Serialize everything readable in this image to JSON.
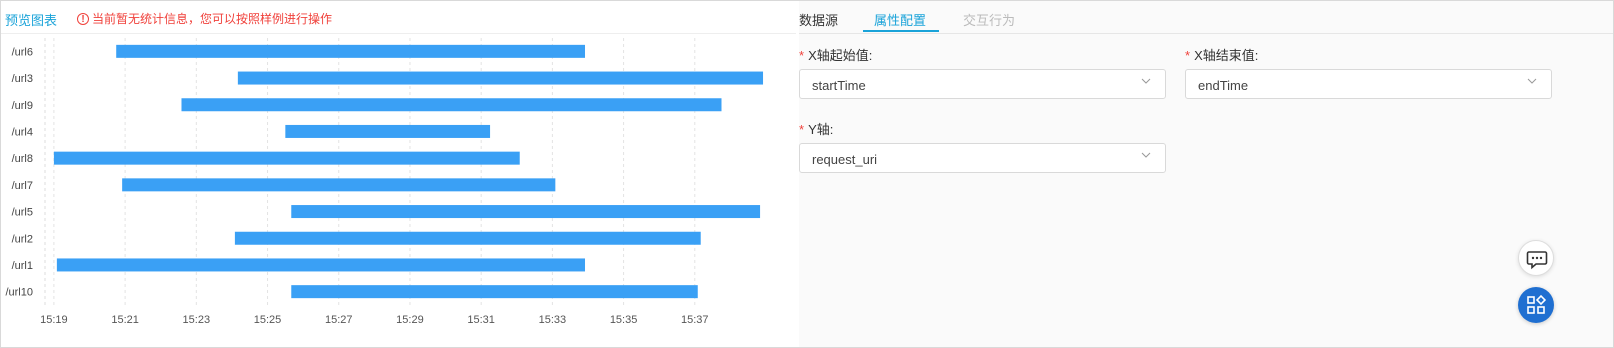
{
  "preview": {
    "title": "预览图表",
    "warning_icon": "exclamation-circle-icon",
    "warning": "当前暂无统计信息，您可以按照样例进行操作"
  },
  "tabs": [
    {
      "label": "数据源",
      "state": "normal"
    },
    {
      "label": "属性配置",
      "state": "active"
    },
    {
      "label": "交互行为",
      "state": "disabled"
    }
  ],
  "form": {
    "x_start": {
      "label": "X轴起始值:",
      "value": "startTime"
    },
    "x_end": {
      "label": "X轴结束值:",
      "value": "endTime"
    },
    "y_axis": {
      "label": "Y轴:",
      "value": "request_uri"
    }
  },
  "fabs": {
    "comment_icon": "comment-icon",
    "apps_icon": "apps-icon"
  },
  "colors": {
    "accent": "#1aa3d9",
    "bar": "#3aa0f5",
    "warning": "#f0413b",
    "fab": "#1f6fd1"
  },
  "chart_data": {
    "type": "bar",
    "orientation": "horizontal-range",
    "x_ticks": [
      "15:19",
      "15:21",
      "15:23",
      "15:25",
      "15:27",
      "15:29",
      "15:31",
      "15:33",
      "15:35",
      "15:37"
    ],
    "categories": [
      "/url6",
      "/url3",
      "/url9",
      "/url4",
      "/url8",
      "/url7",
      "/url5",
      "/url2",
      "/url1",
      "/url10"
    ],
    "ranges": [
      {
        "start": "15:20:45",
        "end": "15:33:55"
      },
      {
        "start": "15:24:10",
        "end": "15:38:55"
      },
      {
        "start": "15:22:35",
        "end": "15:37:45"
      },
      {
        "start": "15:25:30",
        "end": "15:31:15"
      },
      {
        "start": "15:19:00",
        "end": "15:32:05"
      },
      {
        "start": "15:20:55",
        "end": "15:33:05"
      },
      {
        "start": "15:25:40",
        "end": "15:38:50"
      },
      {
        "start": "15:24:05",
        "end": "15:37:10"
      },
      {
        "start": "15:19:05",
        "end": "15:33:55"
      },
      {
        "start": "15:25:40",
        "end": "15:37:05"
      }
    ],
    "xlim": [
      "15:18:45",
      "15:39:00"
    ],
    "grid": "vertical dashed"
  }
}
